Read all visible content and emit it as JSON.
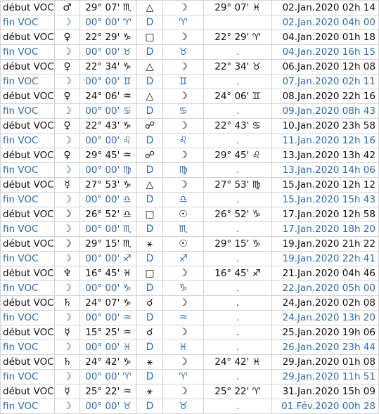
{
  "table": {
    "rows": [
      {
        "type": "start",
        "label": "début VOC",
        "planet": "♂",
        "moon_pos": "29° 07' ♏",
        "aspect": "△",
        "moon": "☽",
        "ingress": "29° 07' ♓",
        "date": "02.Jan.2020 02h 14"
      },
      {
        "type": "end",
        "label": "fin VOC",
        "planet": "☽",
        "moon_pos": "00° 00' ♈",
        "aspect": "D",
        "moon": "♈",
        "ingress": "",
        "date": "02.Jan.2020 04h 00"
      },
      {
        "type": "start",
        "label": "début VOC",
        "planet": "♀",
        "moon_pos": "22° 29' ♑",
        "aspect": "□",
        "moon": "☽",
        "ingress": "22° 29' ♈",
        "date": "04.Jan.2020 01h 18"
      },
      {
        "type": "end",
        "label": "fin VOC",
        "planet": "☽",
        "moon_pos": "00° 00' ♉",
        "aspect": "D",
        "moon": "♉",
        "ingress": ".",
        "date": "04.Jan.2020 16h 15"
      },
      {
        "type": "start",
        "label": "début VOC",
        "planet": "♀",
        "moon_pos": "22° 34' ♑",
        "aspect": "△",
        "moon": "☽",
        "ingress": "22° 34' ♉",
        "date": "06.Jan.2020 12h 08"
      },
      {
        "type": "end",
        "label": "fin VOC",
        "planet": "☽",
        "moon_pos": "00° 00' ♊",
        "aspect": "D",
        "moon": "♊",
        "ingress": ".",
        "date": "07.Jan.2020 02h 11"
      },
      {
        "type": "start",
        "label": "début VOC",
        "planet": "♀",
        "moon_pos": "24° 06' ♒",
        "aspect": "△",
        "moon": "☽",
        "ingress": "24° 06' ♊",
        "date": "08.Jan.2020 22h 16"
      },
      {
        "type": "end",
        "label": "fin VOC",
        "planet": "☽",
        "moon_pos": "00° 00' ♋",
        "aspect": "D",
        "moon": "♋",
        "ingress": ".",
        "date": "09.Jan.2020 08h 43"
      },
      {
        "type": "start",
        "label": "début VOC",
        "planet": "♀",
        "moon_pos": "22° 43' ♑",
        "aspect": "☍",
        "moon": "☽",
        "ingress": "22° 43' ♋",
        "date": "10.Jan.2020 23h 58"
      },
      {
        "type": "end",
        "label": "fin VOC",
        "planet": "☽",
        "moon_pos": "00° 00' ♌",
        "aspect": "D",
        "moon": "♌",
        "ingress": ".",
        "date": "11.Jan.2020 12h 16"
      },
      {
        "type": "start",
        "label": "début VOC",
        "planet": "♀",
        "moon_pos": "29° 45' ♒",
        "aspect": "☍",
        "moon": "☽",
        "ingress": "29° 45' ♌",
        "date": "13.Jan.2020 13h 42"
      },
      {
        "type": "end",
        "label": "fin VOC",
        "planet": "☽",
        "moon_pos": "00° 00' ♍",
        "aspect": "D",
        "moon": "♍",
        "ingress": ".",
        "date": "13.Jan.2020 14h 06"
      },
      {
        "type": "start",
        "label": "début VOC",
        "planet": "☿",
        "moon_pos": "27° 53' ♑",
        "aspect": "△",
        "moon": "☽",
        "ingress": "27° 53' ♍",
        "date": "15.Jan.2020 12h 12"
      },
      {
        "type": "end",
        "label": "fin VOC",
        "planet": "☽",
        "moon_pos": "00° 00' ♎",
        "aspect": "D",
        "moon": "♎",
        "ingress": ".",
        "date": "15.Jan.2020 15h 43"
      },
      {
        "type": "start",
        "label": "début VOC",
        "planet": "☽",
        "moon_pos": "26° 52' ♎",
        "aspect": "□",
        "moon": "☉",
        "ingress": "26° 52' ♑",
        "date": "17.Jan.2020 12h 58"
      },
      {
        "type": "end",
        "label": "fin VOC",
        "planet": "☽",
        "moon_pos": "00° 00' ♏",
        "aspect": "D",
        "moon": "♏",
        "ingress": ".",
        "date": "17.Jan.2020 18h 20"
      },
      {
        "type": "start",
        "label": "début VOC",
        "planet": "☽",
        "moon_pos": "29° 15' ♏",
        "aspect": "⚹",
        "moon": "☉",
        "ingress": "29° 15' ♑",
        "date": "19.Jan.2020 21h 22"
      },
      {
        "type": "end",
        "label": "fin VOC",
        "planet": "☽",
        "moon_pos": "00° 00' ♐",
        "aspect": "D",
        "moon": "♐",
        "ingress": ".",
        "date": "19.Jan.2020 22h 41"
      },
      {
        "type": "start",
        "label": "début VOC",
        "planet": "♆",
        "moon_pos": "16° 45' ♓",
        "aspect": "□",
        "moon": "☽",
        "ingress": "16° 45' ♐",
        "date": "21.Jan.2020 04h 46"
      },
      {
        "type": "end",
        "label": "fin VOC",
        "planet": "☽",
        "moon_pos": "00° 00' ♑",
        "aspect": "D",
        "moon": "♑",
        "ingress": ".",
        "date": "22.Jan.2020 05h 00"
      },
      {
        "type": "start",
        "label": "début VOC",
        "planet": "♄",
        "moon_pos": "24° 07' ♑",
        "aspect": "☌",
        "moon": "☽",
        "ingress": ".",
        "date": "24.Jan.2020 02h 08"
      },
      {
        "type": "end",
        "label": "fin VOC",
        "planet": "☽",
        "moon_pos": "00° 00' ♒",
        "aspect": "D",
        "moon": "♒",
        "ingress": ".",
        "date": "24.Jan.2020 13h 20"
      },
      {
        "type": "start",
        "label": "début VOC",
        "planet": "☿",
        "moon_pos": "15° 25' ♒",
        "aspect": "☌",
        "moon": "☽",
        "ingress": ".",
        "date": "25.Jan.2020 19h 06"
      },
      {
        "type": "end",
        "label": "fin VOC",
        "planet": "☽",
        "moon_pos": "00° 00' ♓",
        "aspect": "D",
        "moon": "♓",
        "ingress": ".",
        "date": "26.Jan.2020 23h 44"
      },
      {
        "type": "start",
        "label": "début VOC",
        "planet": "♄",
        "moon_pos": "24° 42' ♑",
        "aspect": "⚹",
        "moon": "☽",
        "ingress": "24° 42' ♓",
        "date": "29.Jan.2020 01h 08"
      },
      {
        "type": "end",
        "label": "fin VOC",
        "planet": "☽",
        "moon_pos": "00° 00' ♈",
        "aspect": "D",
        "moon": "♈",
        "ingress": ".",
        "date": "29.Jan.2020 11h 51"
      },
      {
        "type": "start",
        "label": "début VOC",
        "planet": "☿",
        "moon_pos": "25° 22' ♒",
        "aspect": "⚹",
        "moon": "☽",
        "ingress": "25° 22' ♈",
        "date": "31.Jan.2020 15h 09"
      },
      {
        "type": "end",
        "label": "fin VOC",
        "planet": "☽",
        "moon_pos": "00° 00' ♉",
        "aspect": "D",
        "moon": "♉",
        "ingress": ".",
        "date": "01.Fév.2020 00h 28"
      }
    ]
  },
  "colors": {
    "start_text": "#111111",
    "end_text": "#2a6eb4",
    "grid": "#d4d4d4"
  }
}
